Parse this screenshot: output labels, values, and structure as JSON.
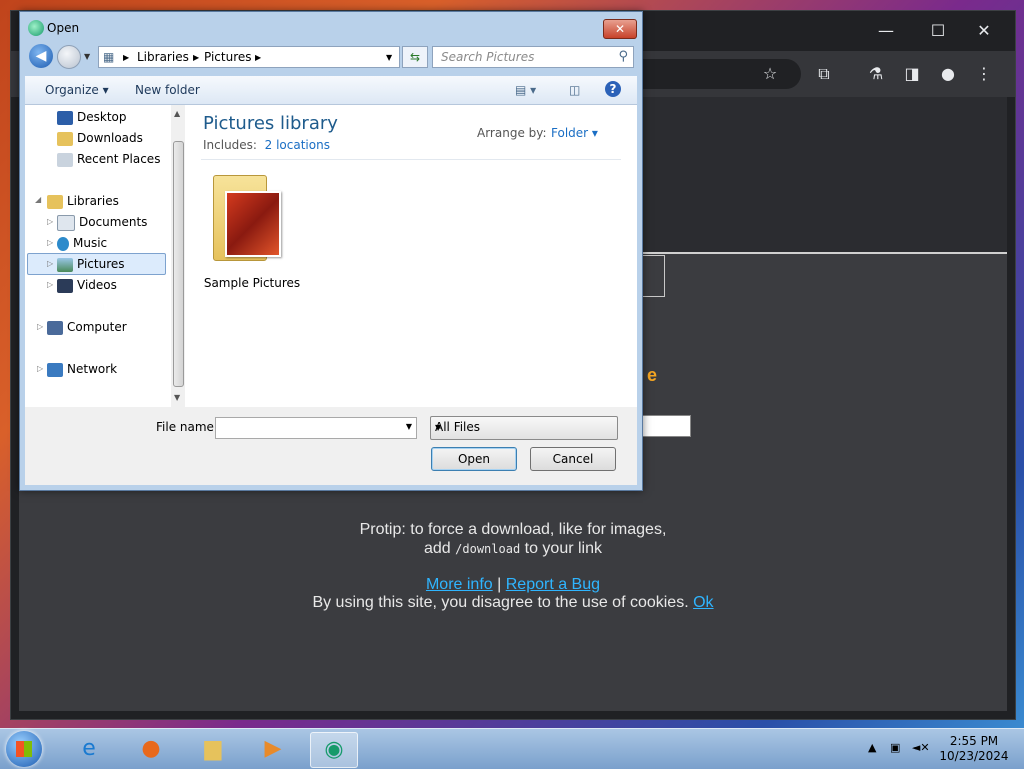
{
  "dialog": {
    "title": "Open",
    "address": {
      "seg1": "Libraries",
      "seg2": "Pictures"
    },
    "search_placeholder": "Search Pictures",
    "toolbar": {
      "organize": "Organize",
      "new_folder": "New folder"
    },
    "nav": {
      "favorites": [
        "Desktop",
        "Downloads",
        "Recent Places"
      ],
      "libraries": "Libraries",
      "library_items": [
        "Documents",
        "Music",
        "Pictures",
        "Videos"
      ],
      "selected": "Pictures",
      "computer": "Computer",
      "network": "Network"
    },
    "library": {
      "title": "Pictures library",
      "includes_label": "Includes:",
      "includes_link": "2 locations",
      "arrange_label": "Arrange by:",
      "arrange_value": "Folder"
    },
    "files": [
      {
        "name": "Sample Pictures"
      }
    ],
    "filename_label": "File name:",
    "filename_value": "",
    "filter": "All Files",
    "open_label": "Open",
    "cancel_label": "Cancel"
  },
  "page": {
    "protip_line1": "Protip: to force a download, like for images,",
    "protip_line2_pre": "add",
    "protip_code": "/download",
    "protip_line2_post": "to your link",
    "more_info": "More info",
    "separator": "|",
    "report_bug": "Report a Bug",
    "cookie_text": "By using this site, you disagree to the use of cookies.",
    "cookie_ok": "Ok"
  },
  "taskbar": {
    "time": "2:55 PM",
    "date": "10/23/2024"
  }
}
